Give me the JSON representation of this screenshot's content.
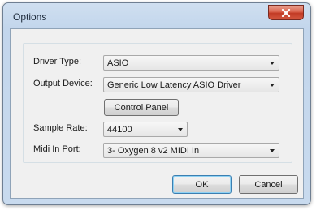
{
  "window": {
    "title": "Options"
  },
  "icons": {
    "close": "close-icon",
    "dropdown": "chevron-down-icon"
  },
  "fields": [
    {
      "label": "Driver Type:",
      "value": "ASIO"
    },
    {
      "label": "Output Device:",
      "value": "Generic Low Latency ASIO Driver"
    },
    {
      "label": "Sample Rate:",
      "value": "44100"
    },
    {
      "label": "Midi In Port:",
      "value": "3- Oxygen 8 v2 MIDI In"
    }
  ],
  "control_panel_label": "Control Panel",
  "ok_label": "OK",
  "cancel_label": "Cancel",
  "colors": {
    "close_button": "#c94a33",
    "title_bar": "#c8daee",
    "client_bg": "#f0f0f0"
  }
}
